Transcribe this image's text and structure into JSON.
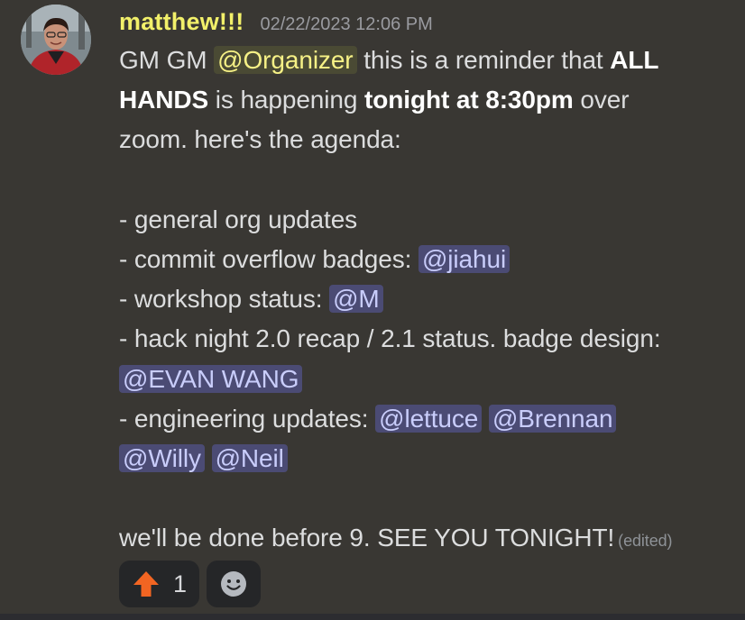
{
  "message": {
    "author": "matthew!!!",
    "timestamp": "02/22/2023 12:06 PM",
    "mentions": {
      "organizer": "@Organizer",
      "jiahui": "@jiahui",
      "m": "@M",
      "evan": "@EVAN WANG",
      "lettuce": "@lettuce",
      "brennan": "@Brennan",
      "willy": "@Willy",
      "neil": "@Neil"
    },
    "text": {
      "gm": "GM GM ",
      "reminder": " this is a reminder that ",
      "all": "ALL",
      "hands": "HANDS",
      "happening": " is happening ",
      "tonight": "tonight at 8:30pm",
      "over": " over",
      "zoom": "zoom. here's the agenda:",
      "item1": "- general org updates",
      "item2": "- commit overflow badges: ",
      "item3": "- workshop status: ",
      "item4": "- hack night 2.0 recap / 2.1 status. badge design:",
      "item5": "- engineering updates: ",
      "closing": "we'll be done before 9. SEE YOU TONIGHT!",
      "edited": "(edited)"
    },
    "reactions": [
      {
        "icon": "up-arrow-icon",
        "count": "1",
        "color": "#f26522"
      }
    ],
    "add_reaction_icon": "smiley-icon"
  }
}
